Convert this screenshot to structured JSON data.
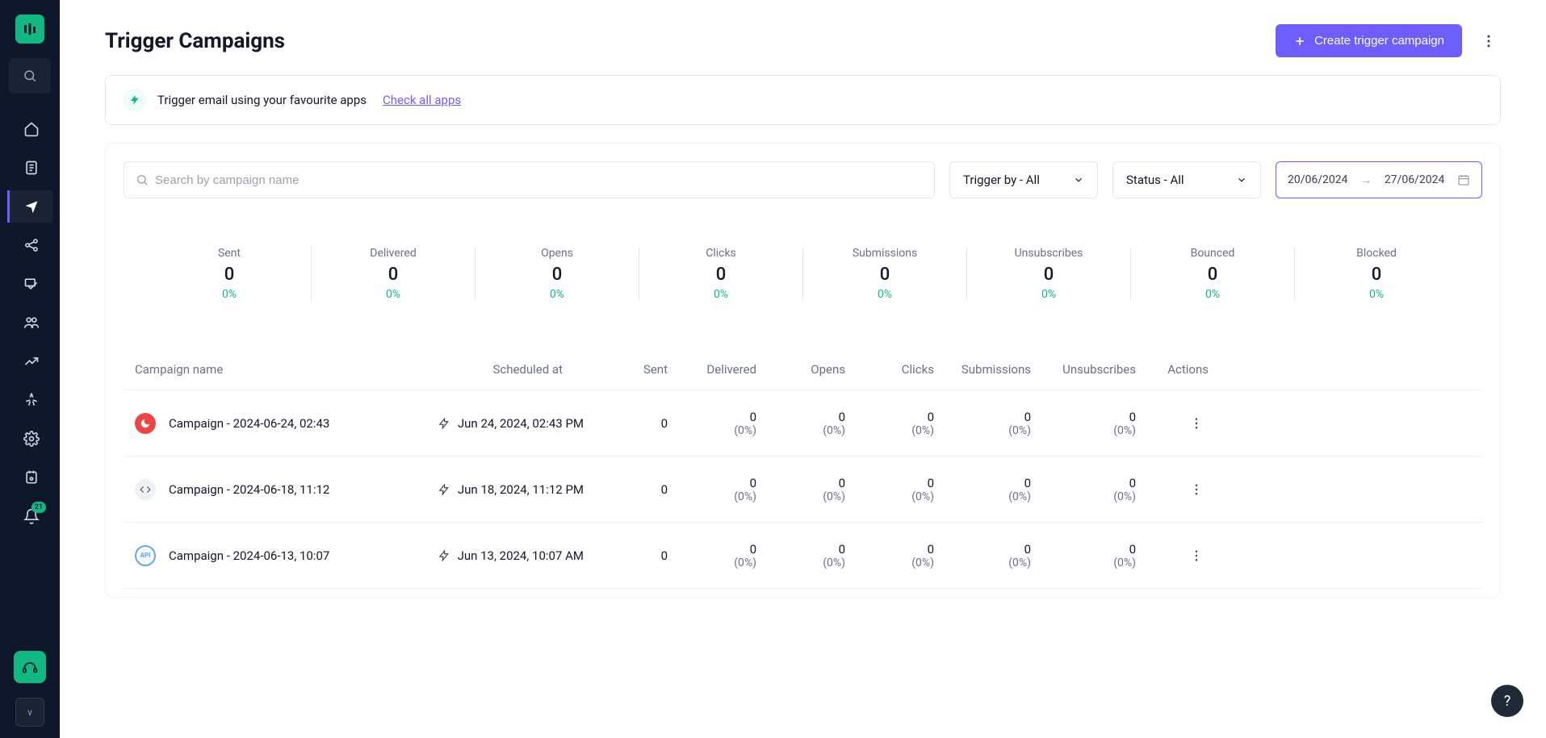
{
  "sidebar": {
    "notification_badge": "21",
    "avatar_initial": "v"
  },
  "header": {
    "title": "Trigger Campaigns",
    "create_button": "Create trigger campaign"
  },
  "banner": {
    "text": "Trigger email using your favourite apps",
    "link": "Check all apps"
  },
  "filters": {
    "search_placeholder": "Search by campaign name",
    "trigger_by": "Trigger by - All",
    "status": "Status - All",
    "date_from": "20/06/2024",
    "date_to": "27/06/2024"
  },
  "stats": [
    {
      "label": "Sent",
      "value": "0",
      "pct": "0%"
    },
    {
      "label": "Delivered",
      "value": "0",
      "pct": "0%"
    },
    {
      "label": "Opens",
      "value": "0",
      "pct": "0%"
    },
    {
      "label": "Clicks",
      "value": "0",
      "pct": "0%"
    },
    {
      "label": "Submissions",
      "value": "0",
      "pct": "0%"
    },
    {
      "label": "Unsubscribes",
      "value": "0",
      "pct": "0%"
    },
    {
      "label": "Bounced",
      "value": "0",
      "pct": "0%"
    },
    {
      "label": "Blocked",
      "value": "0",
      "pct": "0%"
    }
  ],
  "table": {
    "headers": {
      "name": "Campaign name",
      "scheduled": "Scheduled at",
      "sent": "Sent",
      "delivered": "Delivered",
      "opens": "Opens",
      "clicks": "Clicks",
      "submissions": "Submissions",
      "unsubscribes": "Unsubscribes",
      "actions": "Actions"
    },
    "rows": [
      {
        "icon": "red",
        "name": "Campaign - 2024-06-24, 02:43",
        "scheduled": "Jun 24, 2024, 02:43 PM",
        "sent": "0",
        "delivered": {
          "v": "0",
          "p": "(0%)"
        },
        "opens": {
          "v": "0",
          "p": "(0%)"
        },
        "clicks": {
          "v": "0",
          "p": "(0%)"
        },
        "submissions": {
          "v": "0",
          "p": "(0%)"
        },
        "unsubscribes": {
          "v": "0",
          "p": "(0%)"
        }
      },
      {
        "icon": "gray",
        "name": "Campaign - 2024-06-18, 11:12",
        "scheduled": "Jun 18, 2024, 11:12 PM",
        "sent": "0",
        "delivered": {
          "v": "0",
          "p": "(0%)"
        },
        "opens": {
          "v": "0",
          "p": "(0%)"
        },
        "clicks": {
          "v": "0",
          "p": "(0%)"
        },
        "submissions": {
          "v": "0",
          "p": "(0%)"
        },
        "unsubscribes": {
          "v": "0",
          "p": "(0%)"
        }
      },
      {
        "icon": "blue",
        "name": "Campaign - 2024-06-13, 10:07",
        "scheduled": "Jun 13, 2024, 10:07 AM",
        "sent": "0",
        "delivered": {
          "v": "0",
          "p": "(0%)"
        },
        "opens": {
          "v": "0",
          "p": "(0%)"
        },
        "clicks": {
          "v": "0",
          "p": "(0%)"
        },
        "submissions": {
          "v": "0",
          "p": "(0%)"
        },
        "unsubscribes": {
          "v": "0",
          "p": "(0%)"
        }
      }
    ]
  },
  "help": "?"
}
